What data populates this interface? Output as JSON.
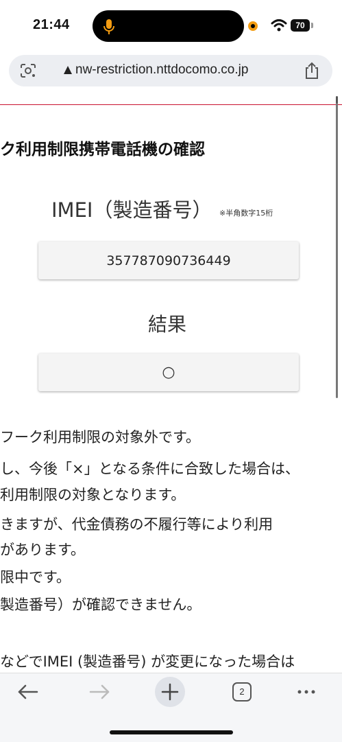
{
  "status_bar": {
    "time": "21:44",
    "battery": "70",
    "accent": "#f39c12"
  },
  "browser": {
    "url": "nw-restriction.nttdocomo.co.jp",
    "tab_count": "2"
  },
  "page": {
    "title": "ク利用制限携帯電話機の確認",
    "imei_label": "IMEI（製造番号）",
    "imei_note": "※半角数字15桁",
    "imei_value": "357787090736449",
    "result_label": "結果",
    "result_value": "○",
    "description_lines": [
      "フーク利用制限の対象外です。",
      "し、今後「×」となる条件に合致した場合は、",
      "利用制限の対象となります。",
      "きますが、代金債務の不履行等により利用",
      "があります。",
      "限中です。",
      "製造番号）が確認できません。",
      "などでIMEI (製造番号) が変更になった場合は"
    ],
    "accent_line_color": "#c8102e"
  },
  "icons": {
    "lens": "google-lens-icon",
    "lock": "lock-icon",
    "share": "share-icon",
    "back": "back-arrow-icon",
    "forward": "forward-arrow-icon",
    "new_tab": "plus-icon",
    "more": "more-dots-icon",
    "mic": "microphone-icon",
    "wifi": "wifi-icon"
  }
}
